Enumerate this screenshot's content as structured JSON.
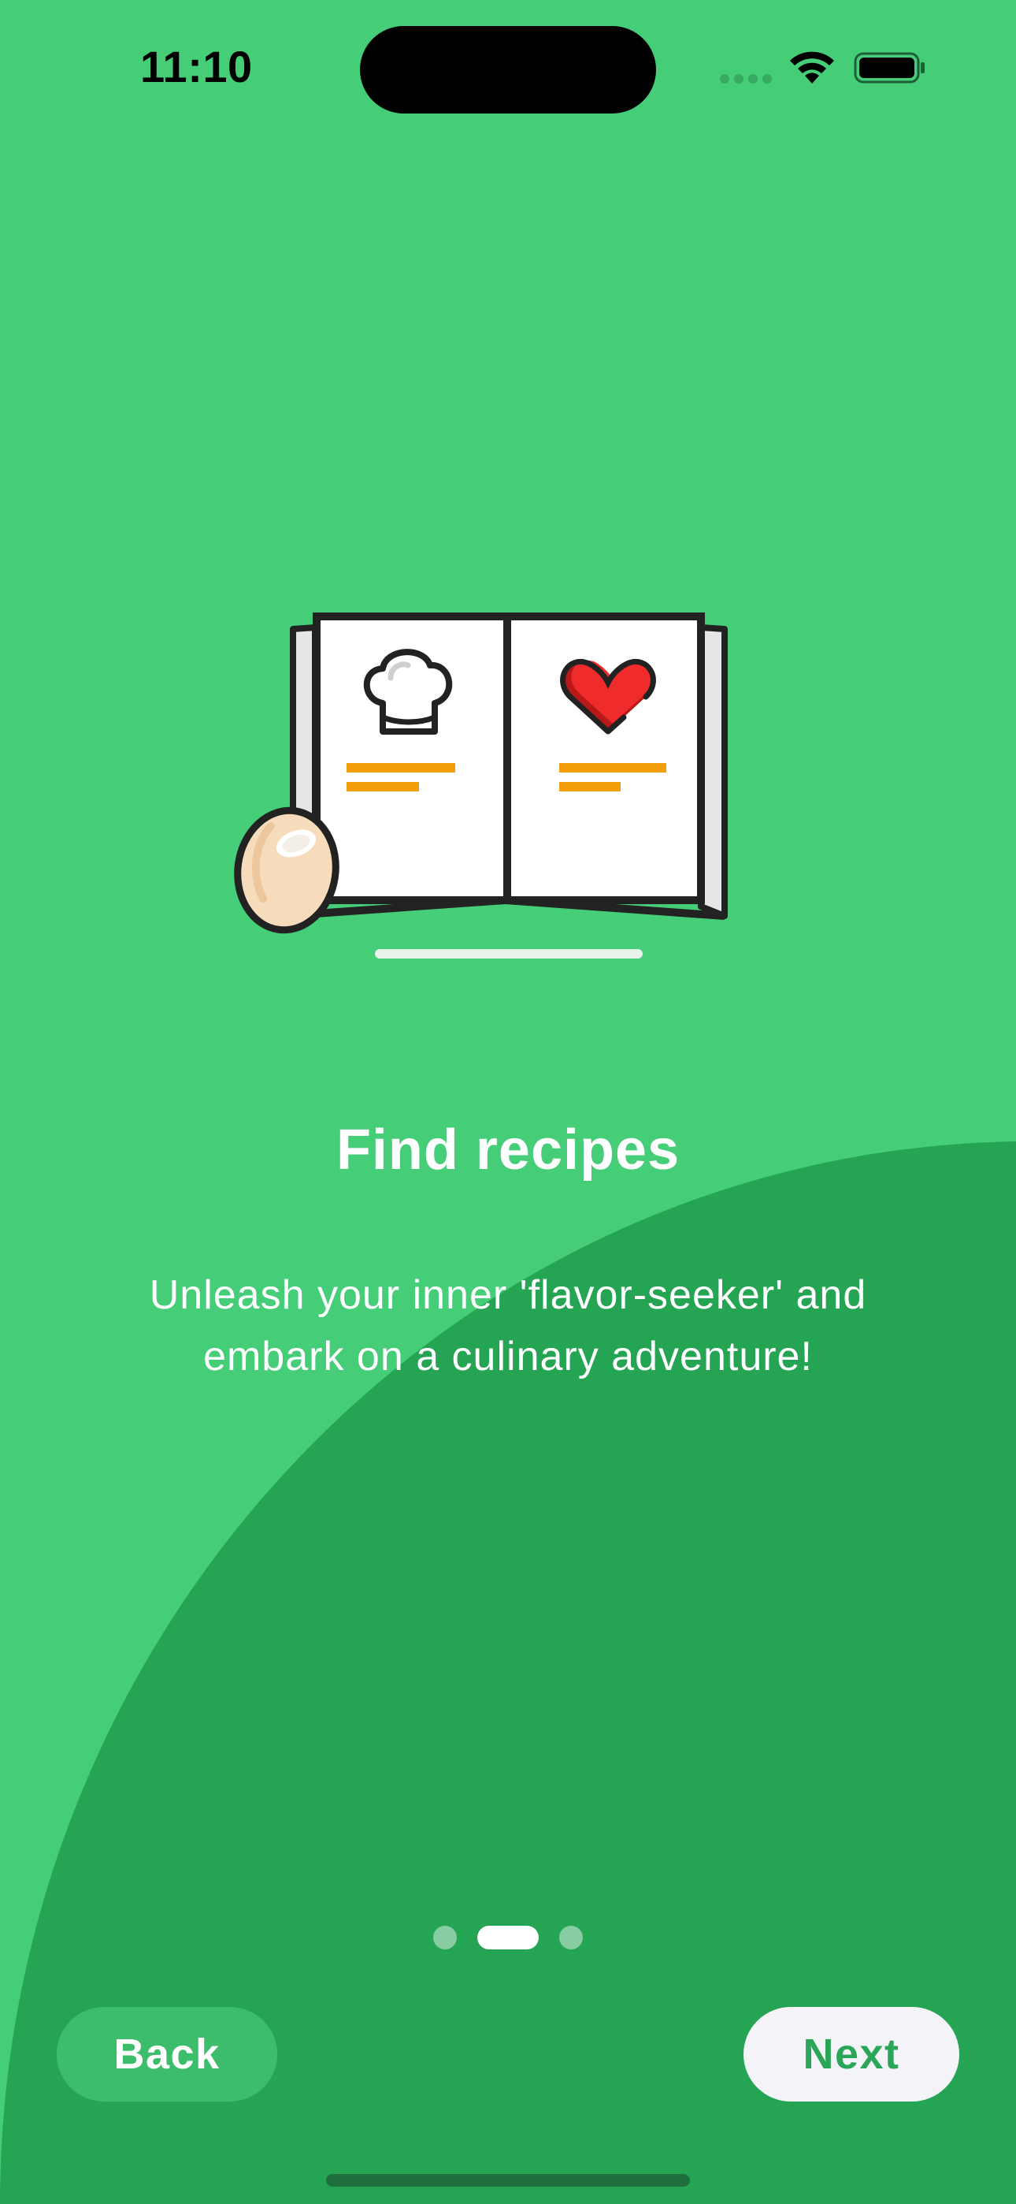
{
  "status_bar": {
    "time": "11:10",
    "icons": [
      "signal-icon",
      "wifi-icon",
      "battery-icon"
    ]
  },
  "onboarding": {
    "illustration": "recipe-book-illustration",
    "title": "Find recipes",
    "subtitle": "Unleash your inner 'flavor-seeker' and embark on a culinary adventure!",
    "page_count": 3,
    "current_page": 2
  },
  "buttons": {
    "back_label": "Back",
    "next_label": "Next"
  },
  "colors": {
    "background": "#46cd78",
    "curve": "#25a554",
    "next_text": "#2ba658",
    "accent_orange": "#f59e0b",
    "heart_red": "#ef2b2b"
  }
}
